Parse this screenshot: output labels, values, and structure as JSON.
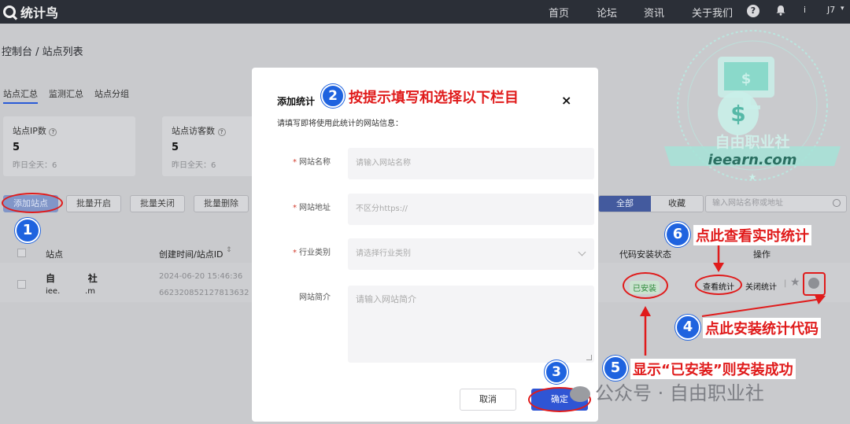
{
  "nav": {
    "logo": "统计鸟",
    "links": [
      "首页",
      "论坛",
      "资讯",
      "关于我们"
    ],
    "help_glyph": "?",
    "user_short": "i",
    "user_name": "J7",
    "user_caret": "▾"
  },
  "page": {
    "breadcrumb": "控制台 / 站点列表",
    "tabs": [
      "站点汇总",
      "监测汇总",
      "站点分组"
    ],
    "stats": [
      {
        "title": "站点IP数",
        "value": "5",
        "sub": "昨日全天：6"
      },
      {
        "title": "站点访客数",
        "value": "5",
        "sub": "昨日全天：6"
      }
    ],
    "buttons": {
      "add": "添加站点",
      "batch_open": "批量开启",
      "batch_close": "批量关闭",
      "batch_delete": "批量删除"
    },
    "filter": {
      "all": "全部",
      "favorites": "收藏"
    },
    "search_placeholder": "输入网站名称或地址",
    "table": {
      "headers": {
        "site": "站点",
        "created": "创建时间/站点ID",
        "code_status": "代码安装状态",
        "actions": "操作"
      },
      "row": {
        "name": "自          社",
        "domain": "iee.          .m",
        "date": "2024-06-20 15:46:36",
        "id": "662320852127813632",
        "status": "已安装",
        "view": "查看统计",
        "close": "关闭统计",
        "sep": "|"
      }
    }
  },
  "modal": {
    "title": "添加统计",
    "close": "×",
    "subtitle": "请填写即将使用此统计的网站信息：",
    "required_mark": "*",
    "fields": [
      {
        "label": "网站名称",
        "placeholder": "请输入网站名称",
        "required": true
      },
      {
        "label": "网站地址",
        "placeholder": "不区分https://",
        "required": true
      },
      {
        "label": "行业类别",
        "placeholder": "请选择行业类别",
        "required": true
      },
      {
        "label": "网站简介",
        "placeholder": "请输入网站简介",
        "required": false
      }
    ],
    "cancel": "取消",
    "confirm": "确定"
  },
  "annotations": {
    "n1": "1",
    "n2": "2",
    "n3": "3",
    "n4": "4",
    "n5": "5",
    "n6": "6",
    "t2": "按提示填写和选择以下栏目",
    "t4": "点此安装统计代码",
    "t5": "显示“已安装”则安装成功",
    "t6": "点此查看实时统计"
  },
  "watermark": {
    "name": "自由职业社",
    "domain": "ieearn.com",
    "wechat": "公众号 · 自由职业社"
  },
  "colors": {
    "topnav": "#2b2f37",
    "primary": "#2f55d4",
    "annotation_red": "#e01b1b",
    "annotation_blue": "#1f63df",
    "installed_green": "#2d8a3a"
  }
}
